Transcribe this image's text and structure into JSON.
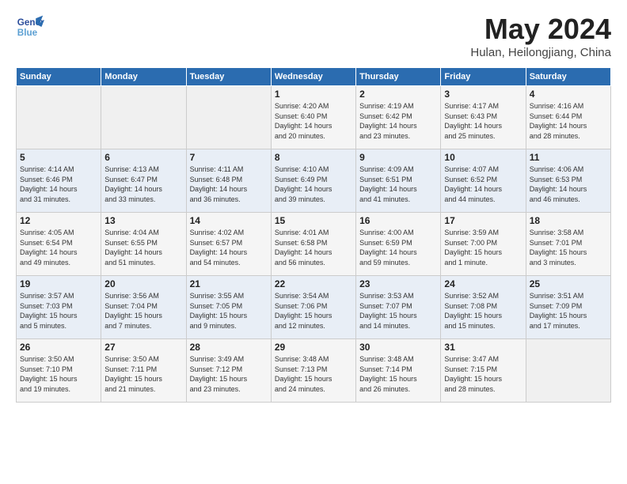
{
  "logo": {
    "line1": "General",
    "line2": "Blue"
  },
  "header": {
    "month": "May 2024",
    "location": "Hulan, Heilongjiang, China"
  },
  "days_of_week": [
    "Sunday",
    "Monday",
    "Tuesday",
    "Wednesday",
    "Thursday",
    "Friday",
    "Saturday"
  ],
  "weeks": [
    [
      {
        "day": "",
        "data": ""
      },
      {
        "day": "",
        "data": ""
      },
      {
        "day": "",
        "data": ""
      },
      {
        "day": "1",
        "data": "Sunrise: 4:20 AM\nSunset: 6:40 PM\nDaylight: 14 hours\nand 20 minutes."
      },
      {
        "day": "2",
        "data": "Sunrise: 4:19 AM\nSunset: 6:42 PM\nDaylight: 14 hours\nand 23 minutes."
      },
      {
        "day": "3",
        "data": "Sunrise: 4:17 AM\nSunset: 6:43 PM\nDaylight: 14 hours\nand 25 minutes."
      },
      {
        "day": "4",
        "data": "Sunrise: 4:16 AM\nSunset: 6:44 PM\nDaylight: 14 hours\nand 28 minutes."
      }
    ],
    [
      {
        "day": "5",
        "data": "Sunrise: 4:14 AM\nSunset: 6:46 PM\nDaylight: 14 hours\nand 31 minutes."
      },
      {
        "day": "6",
        "data": "Sunrise: 4:13 AM\nSunset: 6:47 PM\nDaylight: 14 hours\nand 33 minutes."
      },
      {
        "day": "7",
        "data": "Sunrise: 4:11 AM\nSunset: 6:48 PM\nDaylight: 14 hours\nand 36 minutes."
      },
      {
        "day": "8",
        "data": "Sunrise: 4:10 AM\nSunset: 6:49 PM\nDaylight: 14 hours\nand 39 minutes."
      },
      {
        "day": "9",
        "data": "Sunrise: 4:09 AM\nSunset: 6:51 PM\nDaylight: 14 hours\nand 41 minutes."
      },
      {
        "day": "10",
        "data": "Sunrise: 4:07 AM\nSunset: 6:52 PM\nDaylight: 14 hours\nand 44 minutes."
      },
      {
        "day": "11",
        "data": "Sunrise: 4:06 AM\nSunset: 6:53 PM\nDaylight: 14 hours\nand 46 minutes."
      }
    ],
    [
      {
        "day": "12",
        "data": "Sunrise: 4:05 AM\nSunset: 6:54 PM\nDaylight: 14 hours\nand 49 minutes."
      },
      {
        "day": "13",
        "data": "Sunrise: 4:04 AM\nSunset: 6:55 PM\nDaylight: 14 hours\nand 51 minutes."
      },
      {
        "day": "14",
        "data": "Sunrise: 4:02 AM\nSunset: 6:57 PM\nDaylight: 14 hours\nand 54 minutes."
      },
      {
        "day": "15",
        "data": "Sunrise: 4:01 AM\nSunset: 6:58 PM\nDaylight: 14 hours\nand 56 minutes."
      },
      {
        "day": "16",
        "data": "Sunrise: 4:00 AM\nSunset: 6:59 PM\nDaylight: 14 hours\nand 59 minutes."
      },
      {
        "day": "17",
        "data": "Sunrise: 3:59 AM\nSunset: 7:00 PM\nDaylight: 15 hours\nand 1 minute."
      },
      {
        "day": "18",
        "data": "Sunrise: 3:58 AM\nSunset: 7:01 PM\nDaylight: 15 hours\nand 3 minutes."
      }
    ],
    [
      {
        "day": "19",
        "data": "Sunrise: 3:57 AM\nSunset: 7:03 PM\nDaylight: 15 hours\nand 5 minutes."
      },
      {
        "day": "20",
        "data": "Sunrise: 3:56 AM\nSunset: 7:04 PM\nDaylight: 15 hours\nand 7 minutes."
      },
      {
        "day": "21",
        "data": "Sunrise: 3:55 AM\nSunset: 7:05 PM\nDaylight: 15 hours\nand 9 minutes."
      },
      {
        "day": "22",
        "data": "Sunrise: 3:54 AM\nSunset: 7:06 PM\nDaylight: 15 hours\nand 12 minutes."
      },
      {
        "day": "23",
        "data": "Sunrise: 3:53 AM\nSunset: 7:07 PM\nDaylight: 15 hours\nand 14 minutes."
      },
      {
        "day": "24",
        "data": "Sunrise: 3:52 AM\nSunset: 7:08 PM\nDaylight: 15 hours\nand 15 minutes."
      },
      {
        "day": "25",
        "data": "Sunrise: 3:51 AM\nSunset: 7:09 PM\nDaylight: 15 hours\nand 17 minutes."
      }
    ],
    [
      {
        "day": "26",
        "data": "Sunrise: 3:50 AM\nSunset: 7:10 PM\nDaylight: 15 hours\nand 19 minutes."
      },
      {
        "day": "27",
        "data": "Sunrise: 3:50 AM\nSunset: 7:11 PM\nDaylight: 15 hours\nand 21 minutes."
      },
      {
        "day": "28",
        "data": "Sunrise: 3:49 AM\nSunset: 7:12 PM\nDaylight: 15 hours\nand 23 minutes."
      },
      {
        "day": "29",
        "data": "Sunrise: 3:48 AM\nSunset: 7:13 PM\nDaylight: 15 hours\nand 24 minutes."
      },
      {
        "day": "30",
        "data": "Sunrise: 3:48 AM\nSunset: 7:14 PM\nDaylight: 15 hours\nand 26 minutes."
      },
      {
        "day": "31",
        "data": "Sunrise: 3:47 AM\nSunset: 7:15 PM\nDaylight: 15 hours\nand 28 minutes."
      },
      {
        "day": "",
        "data": ""
      }
    ]
  ]
}
